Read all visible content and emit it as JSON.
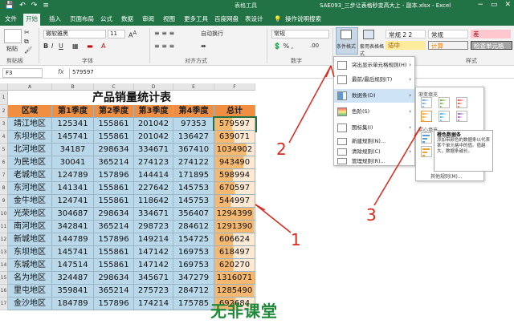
{
  "title_bar": {
    "context_tab": "表格工具",
    "doc_title": "SAE093_三步让表格秒变高大上 - 副本.xlsx  -  Excel",
    "quick_access": [
      "💾",
      "↶",
      "↷",
      "≡"
    ],
    "window_controls": [
      "−",
      "▭",
      "✕"
    ]
  },
  "menu": {
    "tabs": [
      "文件",
      "开始",
      "插入",
      "页面布局",
      "公式",
      "数据",
      "审阅",
      "视图",
      "更多工具",
      "百度网盘",
      "表设计"
    ],
    "search_label": "操作说明搜索"
  },
  "ribbon": {
    "paste_label": "粘贴",
    "clipboard_label": "剪贴板",
    "font_name": "微软雅黑",
    "font_size": "11",
    "font_label": "字体",
    "align_label": "对齐方式",
    "wrap_label": "自动换行",
    "number_format": "常规",
    "number_label": "数字",
    "cond_format_label": "条件格式",
    "table_format_label": "套用表格格式",
    "styles": {
      "normal2": "常规 2 2",
      "normal": "常规",
      "bad": "差",
      "neutral": "适中",
      "calc": "计算",
      "check": "检查单元格"
    },
    "styles_label": "样式"
  },
  "formula_bar": {
    "name_box": "F3",
    "fx": "fx",
    "value": "579597"
  },
  "columns": [
    "A",
    "B",
    "C",
    "D",
    "E",
    "F"
  ],
  "sheet": {
    "title": "产品销量统计表",
    "headers": [
      "区域",
      "第1季度",
      "第2季度",
      "第3季度",
      "第4季度",
      "总计"
    ],
    "rows": [
      [
        "靖江地区",
        "125341",
        "155861",
        "201042",
        "97353",
        "579597"
      ],
      [
        "东坝地区",
        "145741",
        "155861",
        "201042",
        "136427",
        "639071"
      ],
      [
        "北河地区",
        "34187",
        "298634",
        "334671",
        "367410",
        "1034902"
      ],
      [
        "为民地区",
        "30041",
        "365214",
        "274123",
        "274122",
        "943490"
      ],
      [
        "老城地区",
        "124789",
        "157896",
        "144414",
        "171895",
        "598994"
      ],
      [
        "东河地区",
        "141341",
        "155861",
        "227642",
        "145753",
        "670597"
      ],
      [
        "金牛地区",
        "124741",
        "155861",
        "118642",
        "145753",
        "544997"
      ],
      [
        "光荣地区",
        "304687",
        "298634",
        "334671",
        "356407",
        "1294399"
      ],
      [
        "南河地区",
        "342841",
        "365214",
        "298723",
        "284612",
        "1291390"
      ],
      [
        "新城地区",
        "144789",
        "157896",
        "149214",
        "154725",
        "606624"
      ],
      [
        "东坝地区",
        "145741",
        "155861",
        "147142",
        "169753",
        "618497"
      ],
      [
        "东城地区",
        "147514",
        "155861",
        "147142",
        "169753",
        "620270"
      ],
      [
        "名为地区",
        "324487",
        "298634",
        "345671",
        "347279",
        "1316071"
      ],
      [
        "里屯地区",
        "359841",
        "365214",
        "275723",
        "284712",
        "1285490"
      ],
      [
        "金沙地区",
        "184789",
        "157896",
        "174214",
        "175785",
        "692684"
      ]
    ],
    "row_numbers": [
      "1",
      "2",
      "3",
      "4",
      "5",
      "6",
      "7",
      "8",
      "9",
      "10",
      "11",
      "12",
      "13",
      "14",
      "15",
      "16",
      "17"
    ]
  },
  "cond_menu": {
    "items": [
      "突出显示单元格规则(H)",
      "最前/最后规则(T)",
      "数据条(D)",
      "色阶(S)",
      "图标集(I)",
      "新建规则(N)...",
      "清除规则(C)",
      "管理规则(R)..."
    ]
  },
  "databar_menu": {
    "gradient_label": "渐变填充",
    "solid_label": "实心填充",
    "more_rules": "其他规则(M)..."
  },
  "tooltip": {
    "title": "橙色数据条",
    "body": "添加带颜色的数据条以代表某个单元格中的值。值越大，数据条越长。"
  },
  "annotations": [
    "1",
    "2",
    "3"
  ],
  "watermark": "无非课堂",
  "colors": {
    "excel_green": "#217346",
    "header_orange": "#f08e42",
    "row_blue": "#b9d9ea",
    "total_orange": "#f5b870",
    "annotation_red": "#d9291c"
  }
}
